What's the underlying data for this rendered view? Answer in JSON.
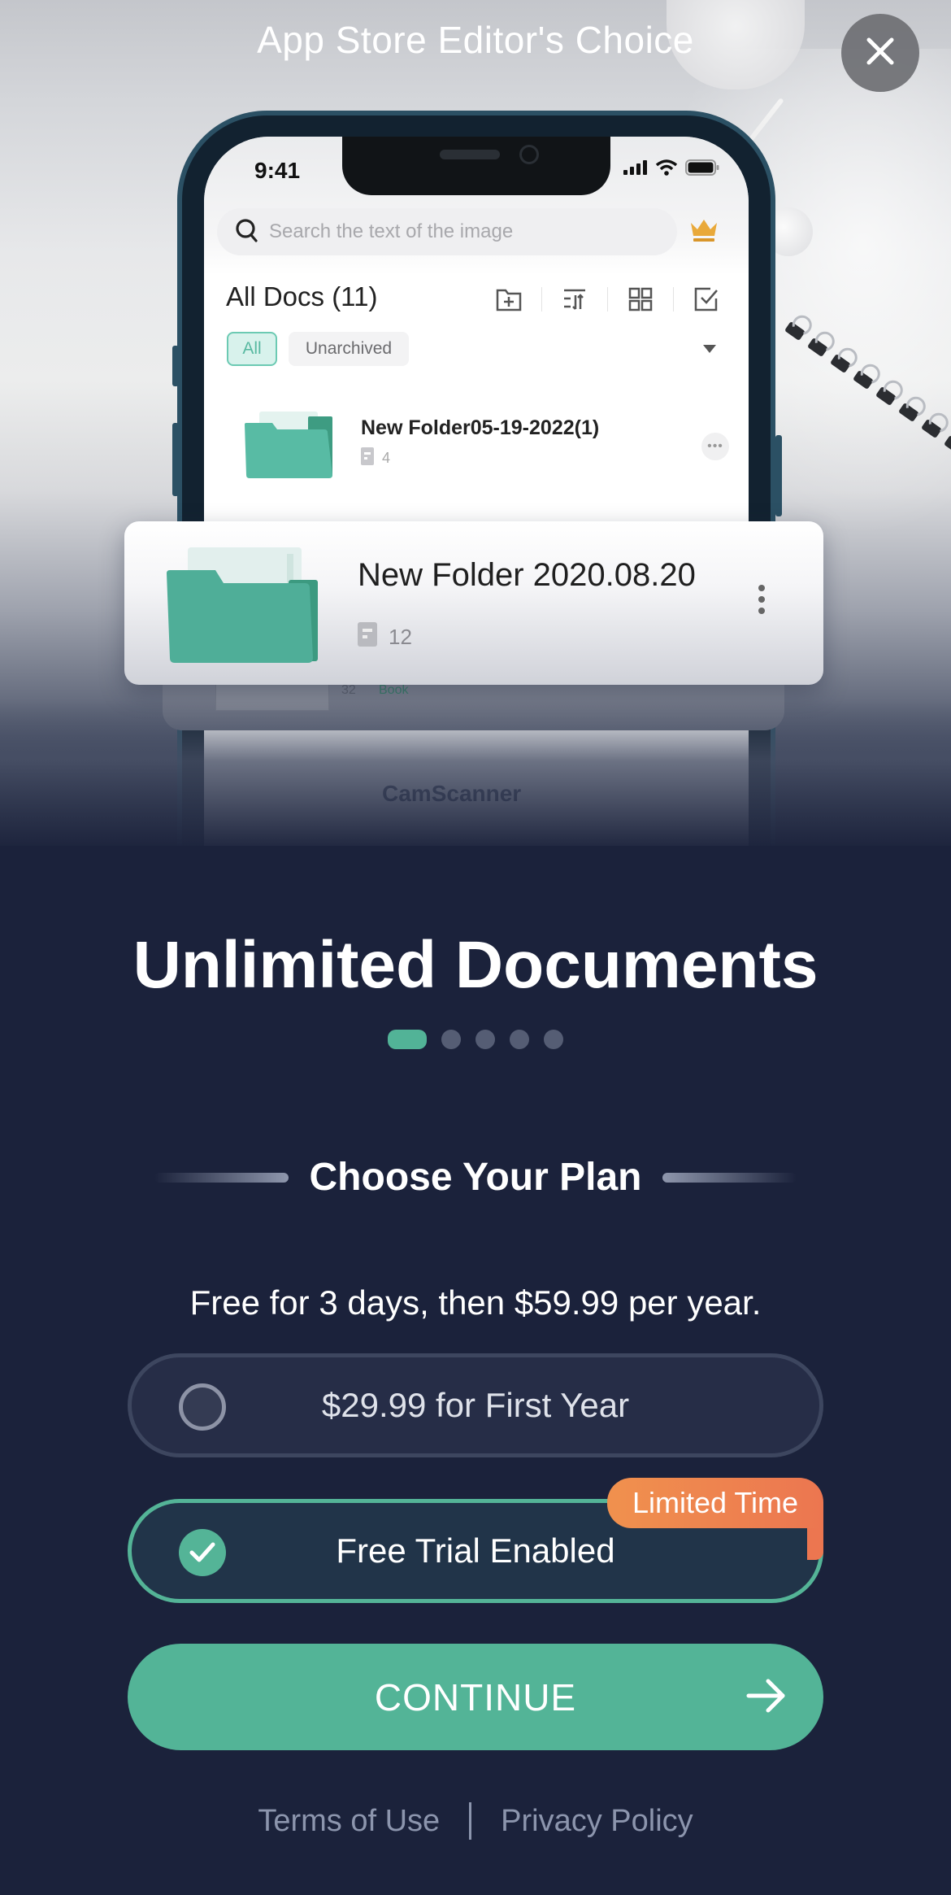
{
  "header": {
    "caption": "App Store Editor's Choice",
    "close_icon": "close-icon"
  },
  "phone_preview": {
    "status_bar": {
      "time": "9:41",
      "icons": [
        "signal-icon",
        "wifi-icon",
        "battery-icon"
      ]
    },
    "search": {
      "placeholder": "Search the text of the image",
      "icon": "search-icon",
      "premium_icon": "crown-icon"
    },
    "docs_title": "All Docs (11)",
    "toolbar_icons": [
      "new-folder-icon",
      "sort-icon",
      "grid-view-icon",
      "select-icon"
    ],
    "filters": {
      "chips": [
        "All",
        "Unarchived"
      ],
      "active": "All",
      "dropdown_icon": "caret-down-icon"
    },
    "folders": [
      {
        "name": "New Folder05-19-2022(1)",
        "doc_count": "4"
      },
      {
        "name": "New Folder 2020.08.20",
        "doc_count": "12"
      }
    ],
    "faded_items": [
      {
        "doc_count": "32",
        "tag": "Book"
      },
      {
        "name": "CamScanner"
      }
    ]
  },
  "feature": {
    "title": "Unlimited Documents",
    "carousel": {
      "total_pages": 5,
      "active_index": 0
    }
  },
  "plans": {
    "heading": "Choose Your Plan",
    "subtitle": "Free for 3 days, then $59.99 per year.",
    "options": [
      {
        "label": "$29.99 for First Year",
        "selected": false
      },
      {
        "label": "Free Trial Enabled",
        "selected": true,
        "badge": "Limited Time"
      }
    ]
  },
  "cta": {
    "label": "CONTINUE",
    "icon": "arrow-right-icon"
  },
  "footer": {
    "terms": "Terms of Use",
    "privacy": "Privacy Policy"
  },
  "colors": {
    "background": "#1b223b",
    "accent": "#53b497",
    "badge": "#ef8450",
    "muted_text": "#8c95ad"
  }
}
